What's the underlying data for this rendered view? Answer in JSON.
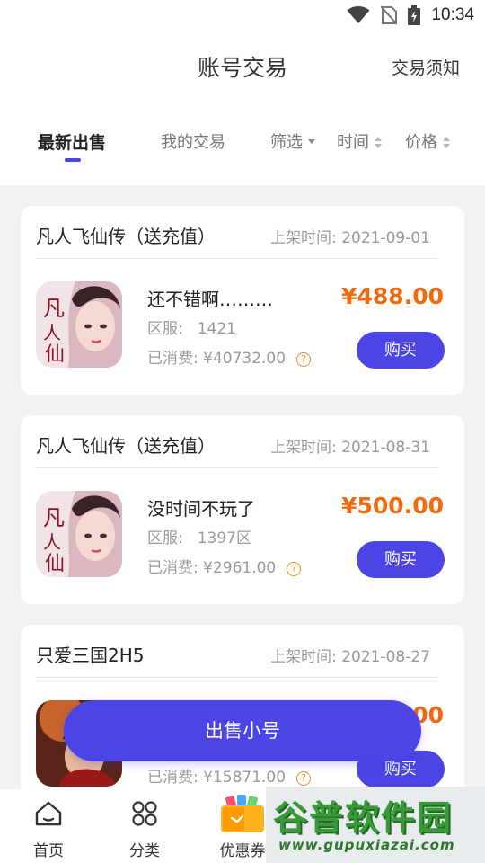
{
  "status_bar": {
    "time": "10:34"
  },
  "header": {
    "title": "账号交易",
    "notice": "交易须知"
  },
  "tabs": [
    {
      "label": "最新出售",
      "active": true
    },
    {
      "label": "我的交易",
      "active": false
    },
    {
      "label": "筛选",
      "kind": "dropdown"
    },
    {
      "label": "时间",
      "kind": "sort"
    },
    {
      "label": "价格",
      "kind": "sort"
    }
  ],
  "listings": [
    {
      "game": "凡人飞仙传（送充值）",
      "date": "上架时间: 2021-09-01",
      "title": "还不错啊………",
      "server_label": "区服:",
      "server": "1421",
      "spent": "已消费: ¥40732.00",
      "price": "¥488.00",
      "buy": "购买"
    },
    {
      "game": "凡人飞仙传（送充值）",
      "date": "上架时间: 2021-08-31",
      "title": "没时间不玩了",
      "server_label": "区服:",
      "server": "1397区",
      "spent": "已消费: ¥2961.00",
      "price": "¥500.00",
      "buy": "购买"
    },
    {
      "game": "只爱三国2H5",
      "date": "上架时间: 2021-08-27",
      "title": "",
      "server_label": "",
      "server": "",
      "spent": "已消费: ¥15871.00",
      "price": "00",
      "buy": "购买"
    }
  ],
  "sell_button": "出售小号",
  "bottom_nav": [
    {
      "label": "首页",
      "icon": "home-icon"
    },
    {
      "label": "分类",
      "icon": "category-icon"
    },
    {
      "label": "优惠券",
      "icon": "coupon-icon"
    }
  ],
  "watermark": {
    "text": "谷普软件园",
    "url": "www.gupuxiazai.com"
  },
  "colors": {
    "accent": "#4c45e6",
    "price": "#f26a10",
    "help": "#f0901a"
  }
}
